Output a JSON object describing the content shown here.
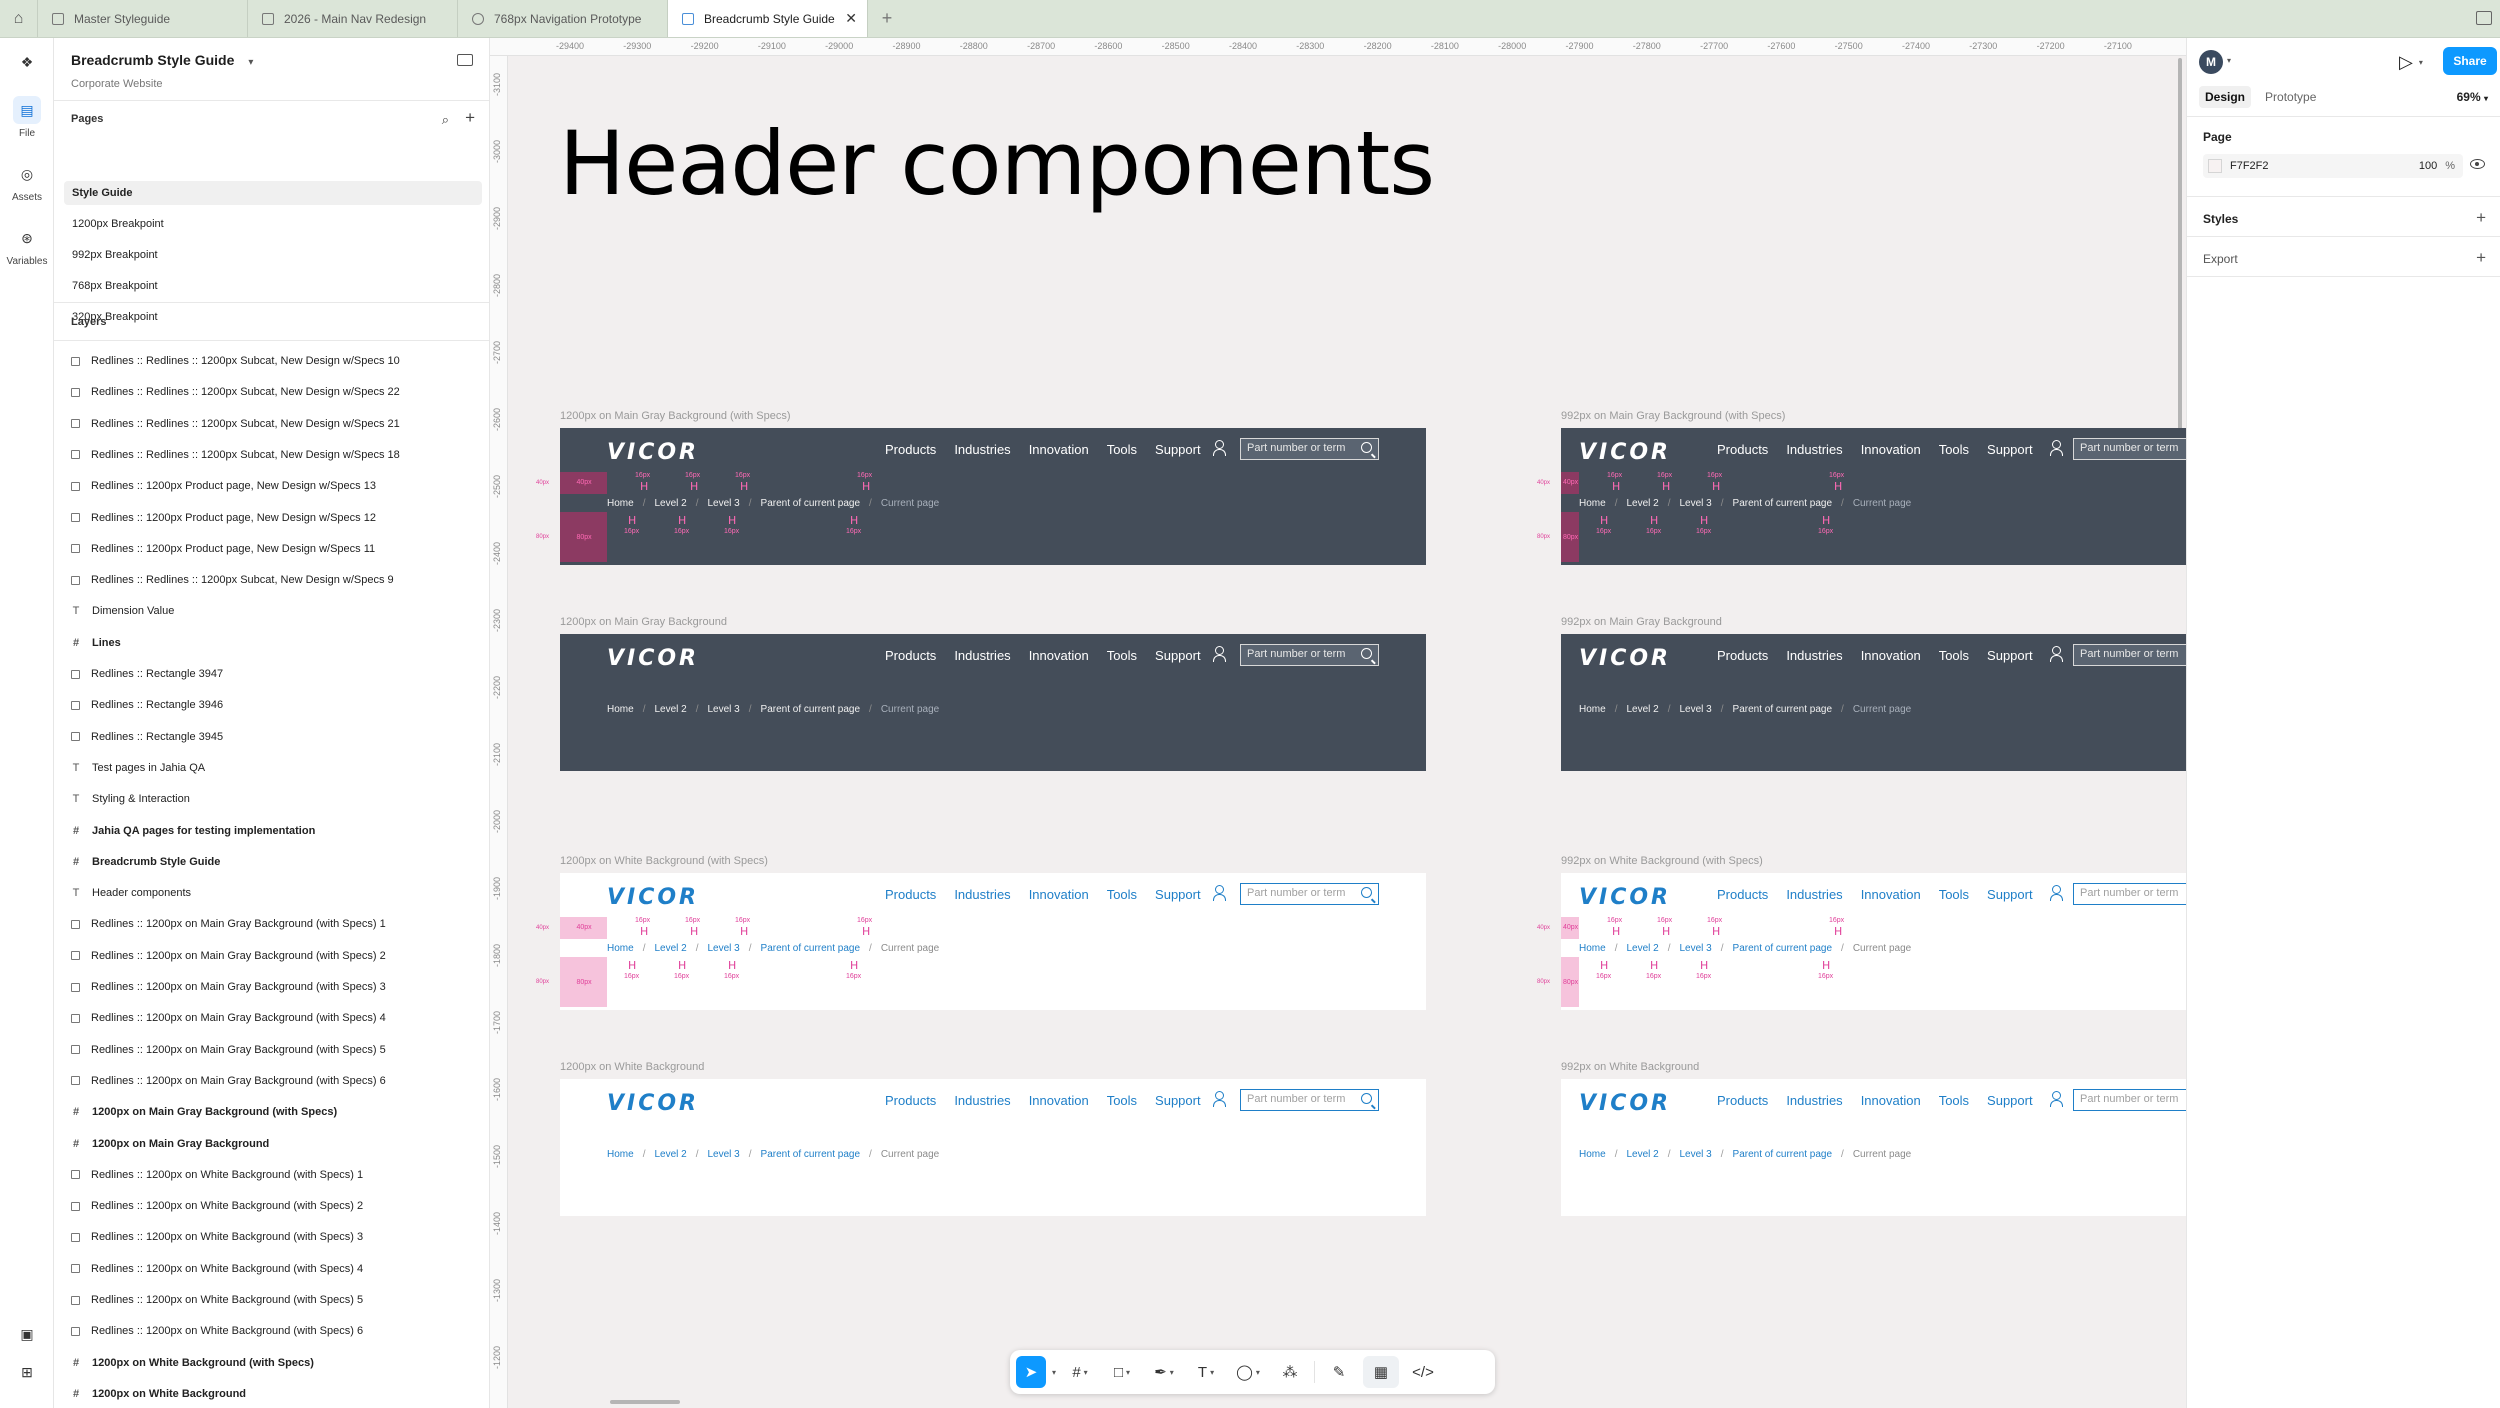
{
  "tabs": [
    {
      "label": "Master Styleguide",
      "active": false
    },
    {
      "label": "2026 - Main Nav Redesign",
      "active": false
    },
    {
      "label": "768px Navigation Prototype",
      "active": false
    },
    {
      "label": "Breadcrumb Style Guide",
      "active": true
    }
  ],
  "rail": {
    "file": "File",
    "assets": "Assets",
    "variables": "Variables"
  },
  "file": {
    "title": "Breadcrumb Style Guide",
    "subtitle": "Corporate Website"
  },
  "pages": {
    "heading": "Pages",
    "items": [
      "Style Guide",
      "1200px Breakpoint",
      "992px Breakpoint",
      "768px Breakpoint",
      "320px Breakpoint"
    ],
    "selected_index": 0
  },
  "layers": {
    "heading": "Layers",
    "items": [
      {
        "icon": "rect",
        "label": "Redlines ::  Redlines ::  1200px Subcat, New Design w/Specs 10",
        "bold": false
      },
      {
        "icon": "rect",
        "label": "Redlines ::  Redlines ::  1200px Subcat, New Design w/Specs 22",
        "bold": false
      },
      {
        "icon": "rect",
        "label": "Redlines ::  Redlines ::  1200px Subcat, New Design w/Specs 21",
        "bold": false
      },
      {
        "icon": "rect",
        "label": "Redlines ::  Redlines ::  1200px Subcat, New Design w/Specs 18",
        "bold": false
      },
      {
        "icon": "rect",
        "label": "Redlines ::  1200px Product page, New Design w/Specs 13",
        "bold": false
      },
      {
        "icon": "rect",
        "label": "Redlines ::  1200px Product page, New Design w/Specs 12",
        "bold": false
      },
      {
        "icon": "rect",
        "label": "Redlines ::  1200px Product page, New Design w/Specs 11",
        "bold": false
      },
      {
        "icon": "rect",
        "label": "Redlines ::  Redlines ::  1200px Subcat, New Design w/Specs 9",
        "bold": false
      },
      {
        "icon": "text",
        "label": "Dimension Value",
        "bold": false
      },
      {
        "icon": "frame",
        "label": "Lines",
        "bold": true
      },
      {
        "icon": "rect",
        "label": "Redlines ::  Rectangle 3947",
        "bold": false
      },
      {
        "icon": "rect",
        "label": "Redlines ::  Rectangle 3946",
        "bold": false
      },
      {
        "icon": "rect",
        "label": "Redlines ::  Rectangle 3945",
        "bold": false
      },
      {
        "icon": "text",
        "label": "Test pages in Jahia QA",
        "bold": false
      },
      {
        "icon": "text",
        "label": "Styling & Interaction",
        "bold": false
      },
      {
        "icon": "frame",
        "label": "Jahia QA pages for testing implementation",
        "bold": true
      },
      {
        "icon": "frame",
        "label": "Breadcrumb Style Guide",
        "bold": true
      },
      {
        "icon": "text",
        "label": "Header components",
        "bold": false
      },
      {
        "icon": "rect",
        "label": "Redlines ::  1200px on Main Gray Background (with Specs) 1",
        "bold": false
      },
      {
        "icon": "rect",
        "label": "Redlines ::  1200px on Main Gray Background (with Specs) 2",
        "bold": false
      },
      {
        "icon": "rect",
        "label": "Redlines ::  1200px on Main Gray Background (with Specs) 3",
        "bold": false
      },
      {
        "icon": "rect",
        "label": "Redlines ::  1200px on Main Gray Background (with Specs) 4",
        "bold": false
      },
      {
        "icon": "rect",
        "label": "Redlines ::  1200px on Main Gray Background (with Specs) 5",
        "bold": false
      },
      {
        "icon": "rect",
        "label": "Redlines ::  1200px on Main Gray Background (with Specs) 6",
        "bold": false
      },
      {
        "icon": "frame",
        "label": "1200px on Main Gray Background (with Specs)",
        "bold": true
      },
      {
        "icon": "frame",
        "label": "1200px on Main Gray Background",
        "bold": true
      },
      {
        "icon": "rect",
        "label": "Redlines ::  1200px on White Background (with Specs) 1",
        "bold": false
      },
      {
        "icon": "rect",
        "label": "Redlines ::  1200px on White Background (with Specs) 2",
        "bold": false
      },
      {
        "icon": "rect",
        "label": "Redlines ::  1200px on White Background (with Specs) 3",
        "bold": false
      },
      {
        "icon": "rect",
        "label": "Redlines ::  1200px on White Background (with Specs) 4",
        "bold": false
      },
      {
        "icon": "rect",
        "label": "Redlines ::  1200px on White Background (with Specs) 5",
        "bold": false
      },
      {
        "icon": "rect",
        "label": "Redlines ::  1200px on White Background (with Specs) 6",
        "bold": false
      },
      {
        "icon": "frame",
        "label": "1200px on White Background (with Specs)",
        "bold": true
      },
      {
        "icon": "frame",
        "label": "1200px on White Background",
        "bold": true
      }
    ]
  },
  "ruler": {
    "top": [
      "-29400",
      "-29300",
      "-29200",
      "-29100",
      "-29000",
      "-28900",
      "-28800",
      "-28700",
      "-28600",
      "-28500",
      "-28400",
      "-28300",
      "-28200",
      "-28100",
      "-28000",
      "-27900",
      "-27800",
      "-27700",
      "-27600",
      "-27500",
      "-27400",
      "-27300",
      "-27200",
      "-27100"
    ],
    "left": [
      "-3100",
      "-3000",
      "-2900",
      "-2800",
      "-2700",
      "-2600",
      "-2500",
      "-2400",
      "-2300",
      "-2200",
      "-2100",
      "-2000",
      "-1900",
      "-1800",
      "-1700",
      "-1600",
      "-1500",
      "-1400",
      "-1300",
      "-1200"
    ]
  },
  "canvas": {
    "heading": "Header components",
    "frame_labels": {
      "gray_specs_1200": "1200px on Main Gray Background (with Specs)",
      "gray_specs_992": "992px on Main Gray Background (with Specs)",
      "gray_1200": "1200px on Main Gray Background",
      "gray_992": "992px on Main Gray Background",
      "white_specs_1200": "1200px on White Background (with Specs)",
      "white_specs_992": "992px on White Background (with Specs)",
      "white_1200": "1200px on White Background",
      "white_992": "992px on White Background"
    },
    "header": {
      "logo": "VICOR",
      "nav": [
        "Products",
        "Industries",
        "Innovation",
        "Tools",
        "Support"
      ],
      "search_placeholder": "Part number or term"
    },
    "breadcrumb": [
      "Home",
      "Level 2",
      "Level 3",
      "Parent of current page",
      "Current page"
    ],
    "breadcrumb_sep": "/",
    "redlines": {
      "top_gap": "40px",
      "bottom_gap": "80px",
      "spacing": "16px",
      "h": "H"
    }
  },
  "toolbar": {
    "help": "?"
  },
  "rightpanel": {
    "avatar": "M",
    "share": "Share",
    "tabs": [
      "Design",
      "Prototype"
    ],
    "zoom": "69%",
    "page_heading": "Page",
    "page_color": "F7F2F2",
    "page_opacity": "100",
    "page_opacity_unit": "%",
    "styles": "Styles",
    "export": "Export"
  },
  "colors": {
    "accent": "#0d99ff",
    "vicor_blue": "#1f7fc8",
    "header_gray": "#444d59",
    "redline_pink": "#e0419a",
    "canvas_bg": "#f2efef"
  }
}
